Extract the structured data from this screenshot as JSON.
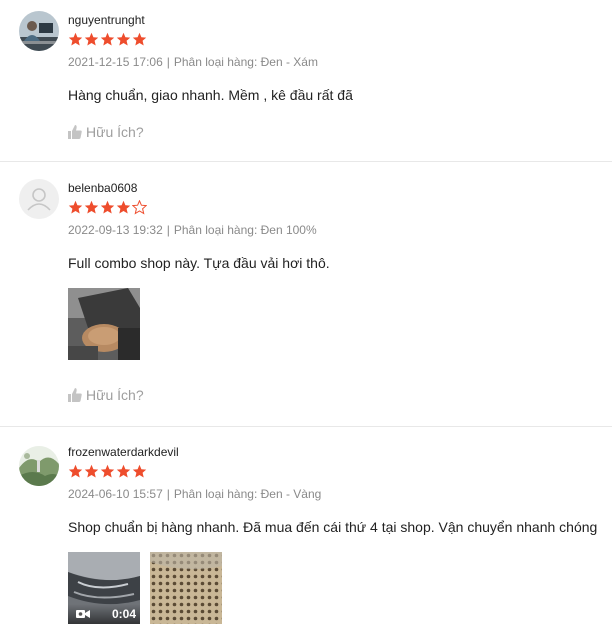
{
  "reviews": [
    {
      "username": "nguyentrunght",
      "rating": 5,
      "date": "2021-12-15 17:06",
      "separator": "|",
      "variant": "Phân loại hàng: Đen - Xám",
      "comment": "Hàng chuẩn, giao nhanh. Mềm , kê đầu rất đã",
      "helpful_label": "Hữu Ích?",
      "avatar_icon": "person-at-desk-photo"
    },
    {
      "username": "belenba0608",
      "rating": 4,
      "date": "2022-09-13 19:32",
      "separator": "|",
      "variant": "Phân loại hàng: Đen 100%",
      "comment": "Full combo shop này. Tựa đầu vải hơi thô.",
      "helpful_label": "Hữu Ích?",
      "avatar_icon": "default-user-icon"
    },
    {
      "username": "frozenwaterdarkdevil",
      "rating": 5,
      "date": "2024-06-10 15:57",
      "separator": "|",
      "variant": "Phân loại hàng: Đen - Vàng",
      "comment": "Shop chuẩn bị hàng nhanh. Đã mua đến cái thứ 4 tại shop. Vận chuyển nhanh chóng",
      "video_duration": "0:04",
      "avatar_icon": "landscape-photo"
    }
  ],
  "colors": {
    "star": "#ee4d2d",
    "meta_text": "#8a8a8a",
    "helpful_text": "#9e9e9e",
    "divider": "#e8e8e8"
  }
}
